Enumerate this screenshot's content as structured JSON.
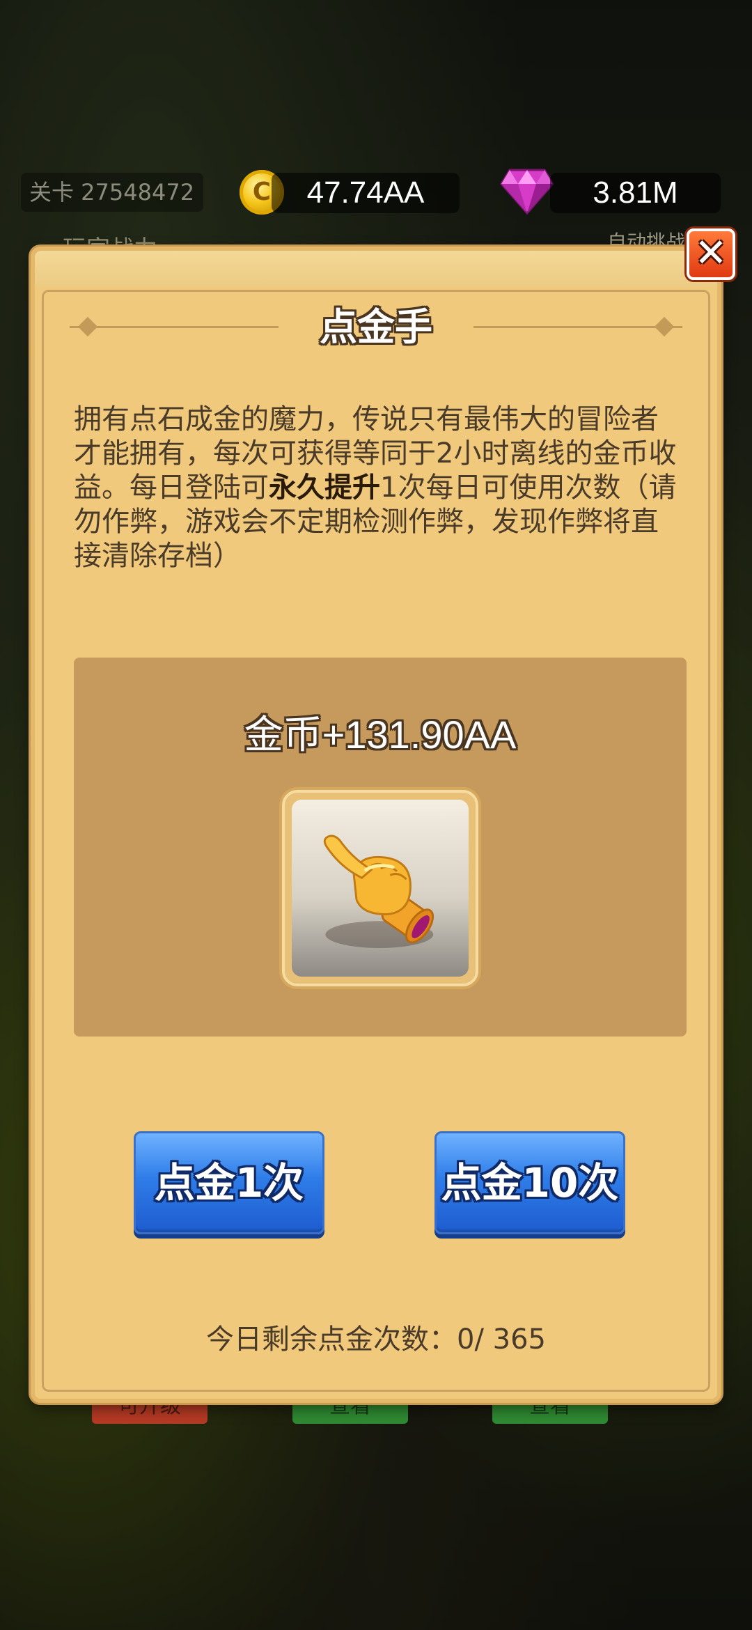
{
  "hud": {
    "level_label": "关卡 27548472",
    "coin_value": "47.74AA",
    "gem_value": "3.81M",
    "faded_left_text": "玩家战力",
    "faded_right_text": "自动挑战"
  },
  "background_buttons": {
    "left": "可升级",
    "middle": "查看",
    "right": "查看"
  },
  "modal": {
    "title": "点金手",
    "description_part1": "拥有点石成金的魔力，传说只有最伟大的冒险者才能拥有，每次可获得等同于2小时离线的金币收益。每日登陆可",
    "description_bold": "永久提升",
    "description_part2": "1次每日可使用次数（请勿作弊，游戏会不定期检测作弊，发现作弊将直接清除存档）",
    "reward_text": "金币+131.90AA",
    "item_icon": "golden-hand-icon",
    "button_once": "点金1次",
    "button_ten": "点金10次",
    "remaining_text": "今日剩余点金次数：0/ 365",
    "close_icon": "close-icon"
  },
  "colors": {
    "modal_bg": "#f0c97d",
    "panel_bg": "#c69a5c",
    "button_blue": "#2f7de8",
    "close_red": "#e03a12",
    "text_brown": "#4a3a28"
  }
}
